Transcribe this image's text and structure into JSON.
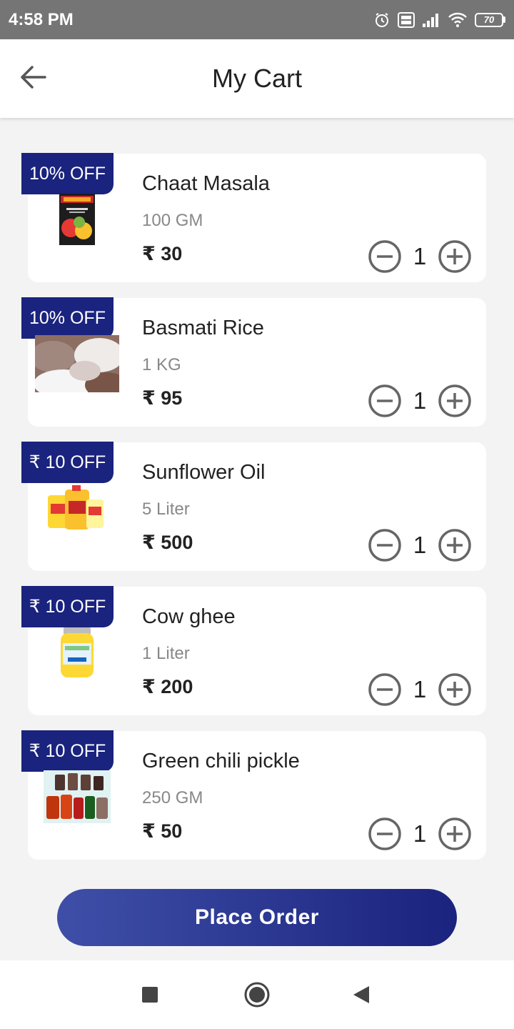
{
  "status_bar": {
    "time": "4:58 PM",
    "battery": "70",
    "icons": [
      "alarm-icon",
      "volte-icon",
      "signal-icon",
      "wifi-icon",
      "battery-icon"
    ]
  },
  "app_bar": {
    "title": "My Cart",
    "back_icon": "arrow-left-icon"
  },
  "currency_symbol": "₹",
  "colors": {
    "brand": "#1a237e",
    "button_gradient_start": "#3f4fa8",
    "status_bar": "#757575"
  },
  "items": [
    {
      "badge": "10% OFF",
      "name": "Chaat Masala",
      "unit": "100 GM",
      "price": "₹ 30",
      "quantity": "1"
    },
    {
      "badge": "10% OFF",
      "name": "Basmati Rice",
      "unit": "1 KG",
      "price": "₹ 95",
      "quantity": "1"
    },
    {
      "badge": "₹ 10 OFF",
      "name": "Sunflower Oil",
      "unit": "5 Liter",
      "price": "₹ 500",
      "quantity": "1"
    },
    {
      "badge": "₹ 10 OFF",
      "name": "Cow ghee",
      "unit": "1 Liter",
      "price": "₹ 200",
      "quantity": "1"
    },
    {
      "badge": "₹ 10 OFF",
      "name": "Green chili pickle",
      "unit": "250 GM",
      "price": "₹ 50",
      "quantity": "1"
    }
  ],
  "place_order_label": "Place Order",
  "nav": [
    "recents-square-icon",
    "home-circle-icon",
    "back-triangle-icon"
  ]
}
